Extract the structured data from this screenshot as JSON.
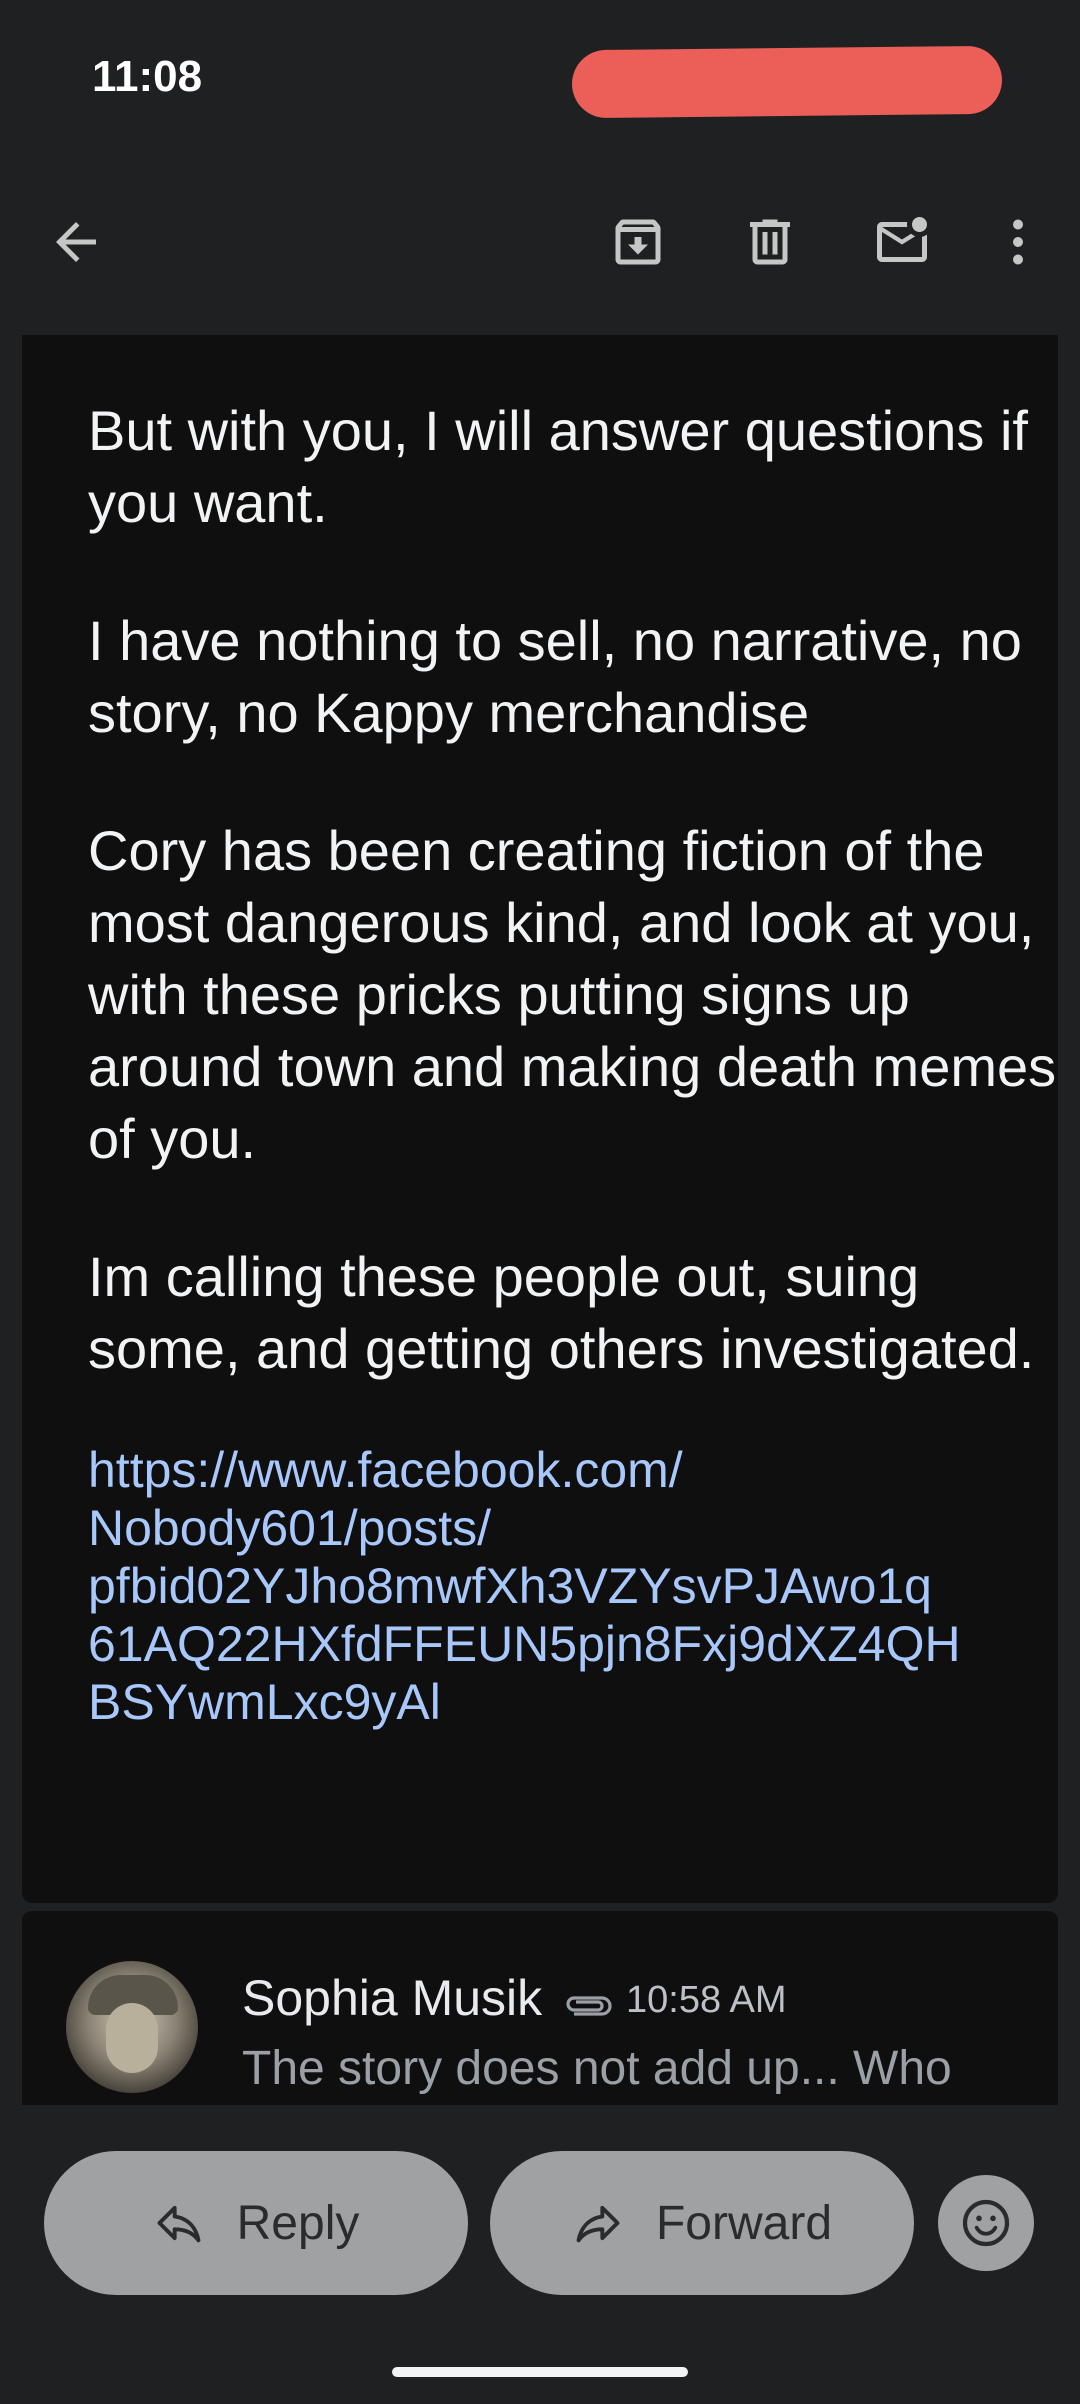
{
  "status_bar": {
    "time": "11:08"
  },
  "toolbar": {
    "icons": [
      "back-arrow-icon",
      "archive-icon",
      "delete-icon",
      "mark-unread-icon",
      "more-vert-icon"
    ]
  },
  "message": {
    "paragraphs": [
      "But with you, I will answer questions if you want.",
      "I have nothing to sell, no narrative, no story, no Kappy merchandise",
      "Cory has been creating fiction of the most dangerous kind, and look at you, with these pricks putting signs up around town and making death memes of you.",
      "Im calling these people out, suing some, and getting others investigated."
    ],
    "link_lines": [
      "https://www.facebook.com/",
      "Nobody601/posts/",
      "pfbid02YJho8mwfXh3VZYsvPJAwo1q",
      "61AQ22HXfdFFEUN5pjn8Fxj9dXZ4QH",
      "BSYwmLxc9yAl"
    ]
  },
  "next_message": {
    "sender": "Sophia Musik",
    "time": "10:58 AM",
    "preview": "The story does not add up... Who"
  },
  "actions": {
    "reply_label": "Reply",
    "forward_label": "Forward"
  },
  "colors": {
    "background": "#1f2021",
    "card": "#0f0f10",
    "link": "#a8c7fa",
    "redaction": "#ec5f58",
    "button": "#a0a1a2"
  }
}
